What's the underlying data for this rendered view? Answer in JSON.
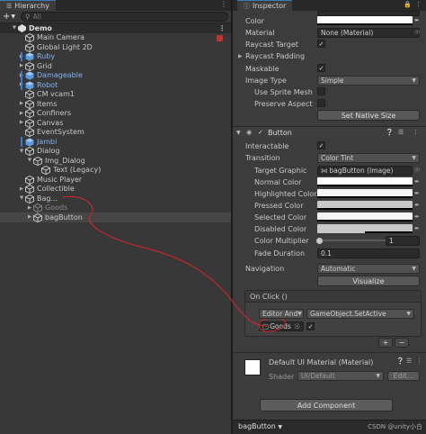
{
  "hierarchy": {
    "tab_title": "Hierarchy",
    "search_placeholder": "All",
    "scene_name": "Demo",
    "items": [
      {
        "label": "Main Camera"
      },
      {
        "label": "Global Light 2D"
      },
      {
        "label": "Ruby"
      },
      {
        "label": "Grid"
      },
      {
        "label": "Damageable"
      },
      {
        "label": "Robot"
      },
      {
        "label": "CM vcam1"
      },
      {
        "label": "Items"
      },
      {
        "label": "Confiners"
      },
      {
        "label": "Canvas"
      },
      {
        "label": "EventSystem"
      },
      {
        "label": "Jambi"
      },
      {
        "label": "Dialog"
      },
      {
        "label": "Img_Dialog"
      },
      {
        "label": "Text (Legacy)"
      },
      {
        "label": "Music Player"
      },
      {
        "label": "Collectible"
      },
      {
        "label": "Bag..."
      },
      {
        "label": "Goods"
      },
      {
        "label": "bagButton"
      }
    ]
  },
  "inspector": {
    "tab_title": "Inspector",
    "image": {
      "color_label": "Color",
      "material_label": "Material",
      "material_value": "None (Material)",
      "raycast_target_label": "Raycast Target",
      "raycast_padding_label": "Raycast Padding",
      "maskable_label": "Maskable",
      "image_type_label": "Image Type",
      "image_type_value": "Simple",
      "use_sprite_mesh_label": "Use Sprite Mesh",
      "preserve_aspect_label": "Preserve Aspect",
      "set_native_size_label": "Set Native Size"
    },
    "button": {
      "title": "Button",
      "interactable_label": "Interactable",
      "transition_label": "Transition",
      "transition_value": "Color Tint",
      "target_graphic_label": "Target Graphic",
      "target_graphic_value": "bagButton (Image)",
      "normal_color_label": "Normal Color",
      "highlighted_color_label": "Highlighted Color",
      "pressed_color_label": "Pressed Color",
      "selected_color_label": "Selected Color",
      "disabled_color_label": "Disabled Color",
      "color_multiplier_label": "Color Multiplier",
      "color_multiplier_value": "1",
      "fade_duration_label": "Fade Duration",
      "fade_duration_value": "0.1",
      "navigation_label": "Navigation",
      "navigation_value": "Automatic",
      "visualize_label": "Visualize",
      "on_click_label": "On Click ()",
      "runtime_value": "Editor And",
      "function_value": "GameObject.SetActive",
      "object_value": "Goods",
      "add_label": "+",
      "remove_label": "−"
    },
    "material": {
      "title": "Default UI Material (Material)",
      "shader_label": "Shader",
      "shader_value": "UI/Default",
      "edit_label": "Edit..."
    },
    "add_component_label": "Add Component",
    "status_object": "bagButton",
    "watermark": "CSDN @unity小白"
  },
  "colors": {
    "accent": "#3a79bb",
    "annotation": "#c0282d",
    "prefab_blue": "#7fb3f5"
  }
}
